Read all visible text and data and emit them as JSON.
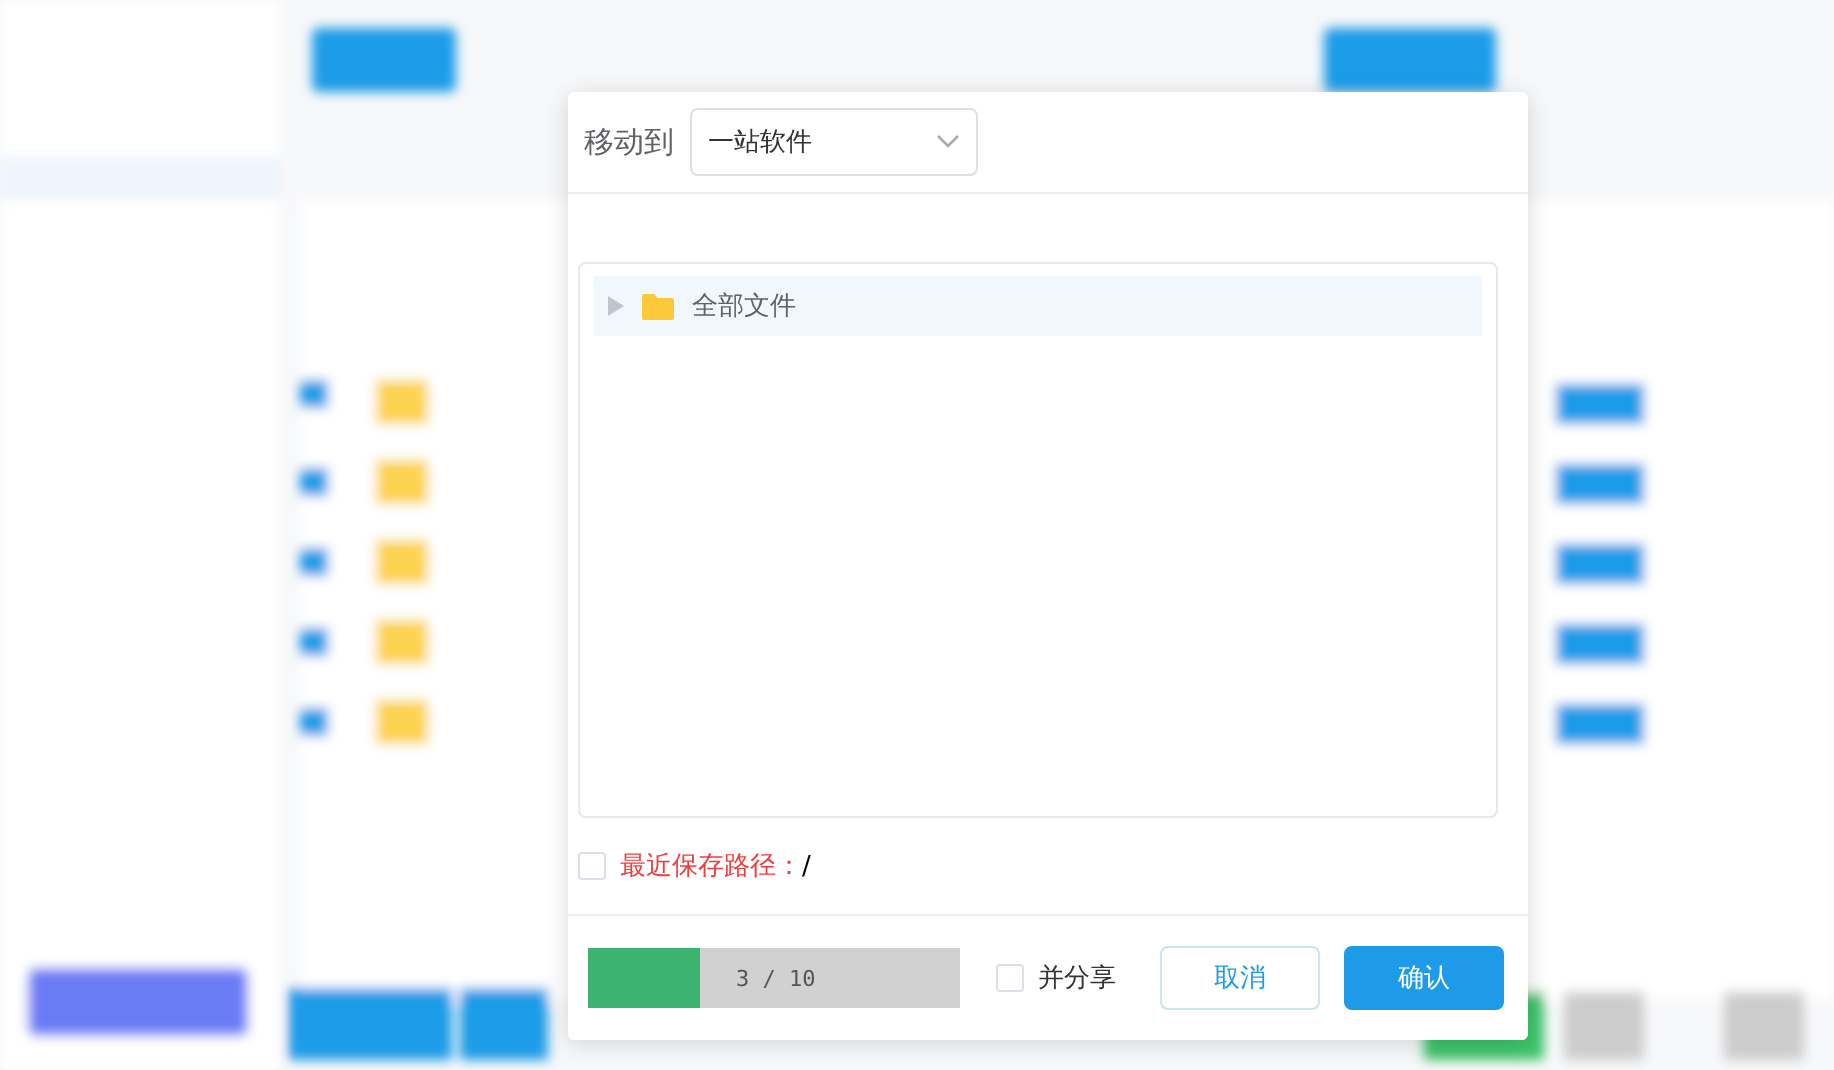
{
  "dialog": {
    "title": "移动到",
    "target_select": {
      "value": "一站软件"
    },
    "tree": [
      {
        "label": "全部文件",
        "expanded": false,
        "selected": true
      }
    ],
    "recent_path": {
      "checked": false,
      "label": "最近保存路径：",
      "value": "/"
    },
    "progress": {
      "level": 0.3,
      "reading": "3 / 10"
    },
    "share": {
      "checked": false,
      "label": "并分享"
    },
    "buttons": [
      {
        "kind": "secondary",
        "label": "取消"
      },
      {
        "kind": "primary",
        "label": "确认"
      }
    ]
  }
}
